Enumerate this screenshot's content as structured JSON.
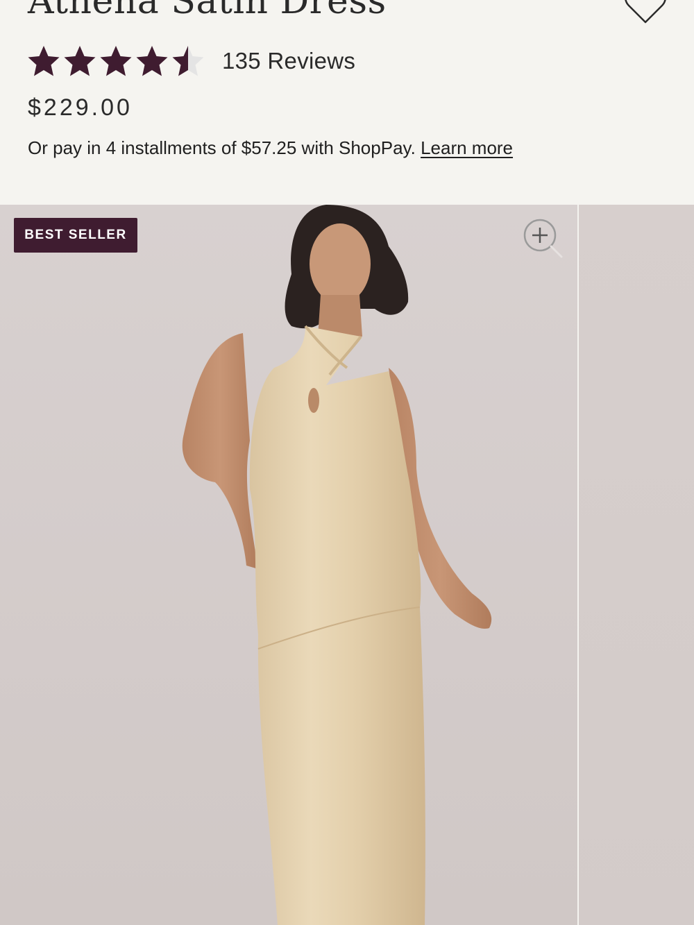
{
  "product": {
    "title": "Athena Satin Dress",
    "rating": {
      "stars_filled": 4.5,
      "stars_total": 5,
      "star_color": "#3f1c30",
      "empty_star_color": "#e4e4e4",
      "reviews_label": "135 Reviews"
    },
    "price": "$229.00",
    "installments": {
      "text": "Or pay in 4 installments of $57.25 with ShopPay.",
      "link_label": "Learn more"
    }
  },
  "gallery": {
    "badge": "BEST SELLER",
    "badge_color": "#3f1c30",
    "zoom_icon": "zoom-in-icon",
    "main_image": "model-in-champagne-satin-halter-dress"
  },
  "accessibility_widget": {
    "icon": "accessibility-icon",
    "color": "#efdde2"
  },
  "wishlist": {
    "icon": "heart-outline-icon"
  }
}
